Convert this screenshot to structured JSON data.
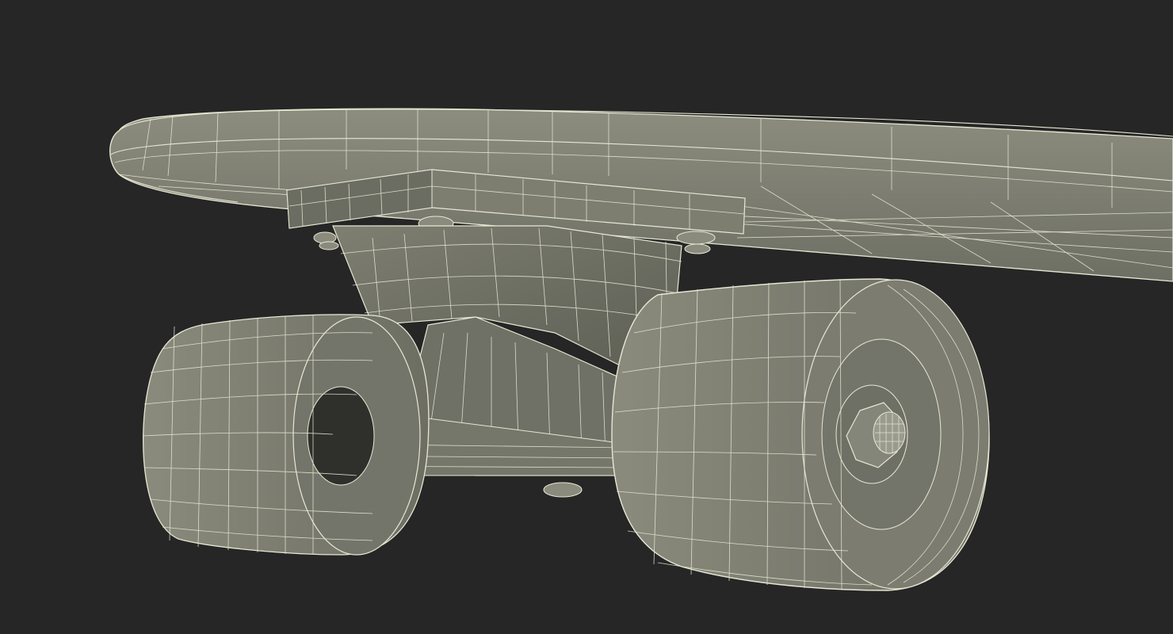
{
  "scene": {
    "background": "#262626",
    "mesh_fill": "#838475",
    "mesh_fill_dark": "#62635a",
    "wire_color": "#e6e8d4"
  }
}
